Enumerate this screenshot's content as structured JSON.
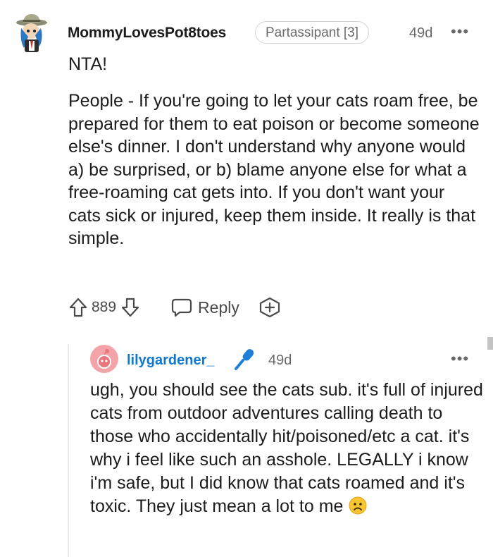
{
  "comment": {
    "username": "MommyLovesPot8toes",
    "flair": "Partassipant [3]",
    "time": "49d",
    "more": "•••",
    "first_line": "NTA!",
    "body": "People - If you're going to let your cats roam free, be prepared for them to eat poison or become someone else's dinner. I don't understand why anyone would a) be surprised, or b) blame anyone else for what a free-roaming cat gets into. If you don't want your cats sick or injured, keep them inside. It really is that simple.",
    "votes": "889",
    "reply_label": "Reply",
    "icons": {
      "avatar": "cowboy-avatar-icon",
      "upvote": "upvote-arrow-icon",
      "downvote": "downvote-arrow-icon",
      "reply": "speech-bubble-icon",
      "award": "award-plus-icon"
    }
  },
  "reply": {
    "username": "lilygardener_",
    "time": "49d",
    "more": "•••",
    "body": "ugh, you should see the cats sub. it's full of injured cats from outdoor adventures calling death to those who accidentally hit/poisoned/etc a cat. it's why i feel like such an asshole. LEGALLY i know i'm safe, but I did know that cats roamed and it's toxic. They just mean a lot to me",
    "icons": {
      "avatar": "snoo-avatar-icon",
      "flair": "microphone-icon",
      "emoji": "sad-face-emoji"
    }
  },
  "colors": {
    "text": "#1c1c1c",
    "meta": "#6a6a6a",
    "username_link": "#0f79d0",
    "avatar_pink": "#f4a4a8",
    "mic_blue": "#1e7fd6"
  }
}
